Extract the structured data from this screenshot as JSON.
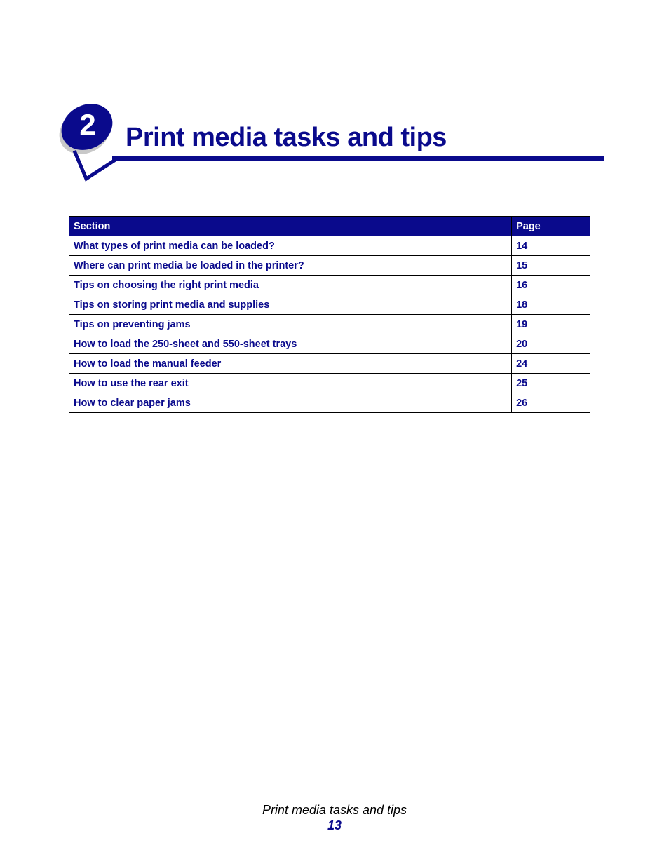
{
  "chapter": {
    "number": "2",
    "title": "Print media tasks and tips"
  },
  "colors": {
    "accent": "#0a0a8c",
    "header_text": "#ffffff",
    "footer_text": "#000000"
  },
  "toc": {
    "headers": {
      "section": "Section",
      "page": "Page"
    },
    "rows": [
      {
        "section": "What types of print media can be loaded?",
        "page": "14"
      },
      {
        "section": "Where can print media be loaded in the printer?",
        "page": "15"
      },
      {
        "section": "Tips on choosing the right print media",
        "page": "16"
      },
      {
        "section": "Tips on storing print media and supplies",
        "page": "18"
      },
      {
        "section": "Tips on preventing jams",
        "page": "19"
      },
      {
        "section": "How to load the 250-sheet and 550-sheet trays",
        "page": "20"
      },
      {
        "section": "How to load the manual feeder",
        "page": "24"
      },
      {
        "section": "How to use the rear exit",
        "page": "25"
      },
      {
        "section": "How to clear paper jams",
        "page": "26"
      }
    ]
  },
  "footer": {
    "title": "Print media tasks and tips",
    "page_number": "13"
  }
}
